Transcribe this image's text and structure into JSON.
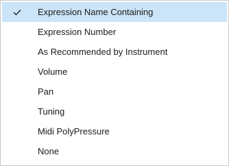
{
  "menu": {
    "check_icon": "checkmark-icon",
    "selected_color": "#cce4f7",
    "items": [
      {
        "label": "Expression Name Containing",
        "checked": true
      },
      {
        "label": "Expression Number",
        "checked": false
      },
      {
        "label": "As Recommended by Instrument",
        "checked": false
      },
      {
        "label": "Volume",
        "checked": false
      },
      {
        "label": "Pan",
        "checked": false
      },
      {
        "label": "Tuning",
        "checked": false
      },
      {
        "label": "Midi PolyPressure",
        "checked": false
      },
      {
        "label": "None",
        "checked": false
      }
    ]
  }
}
